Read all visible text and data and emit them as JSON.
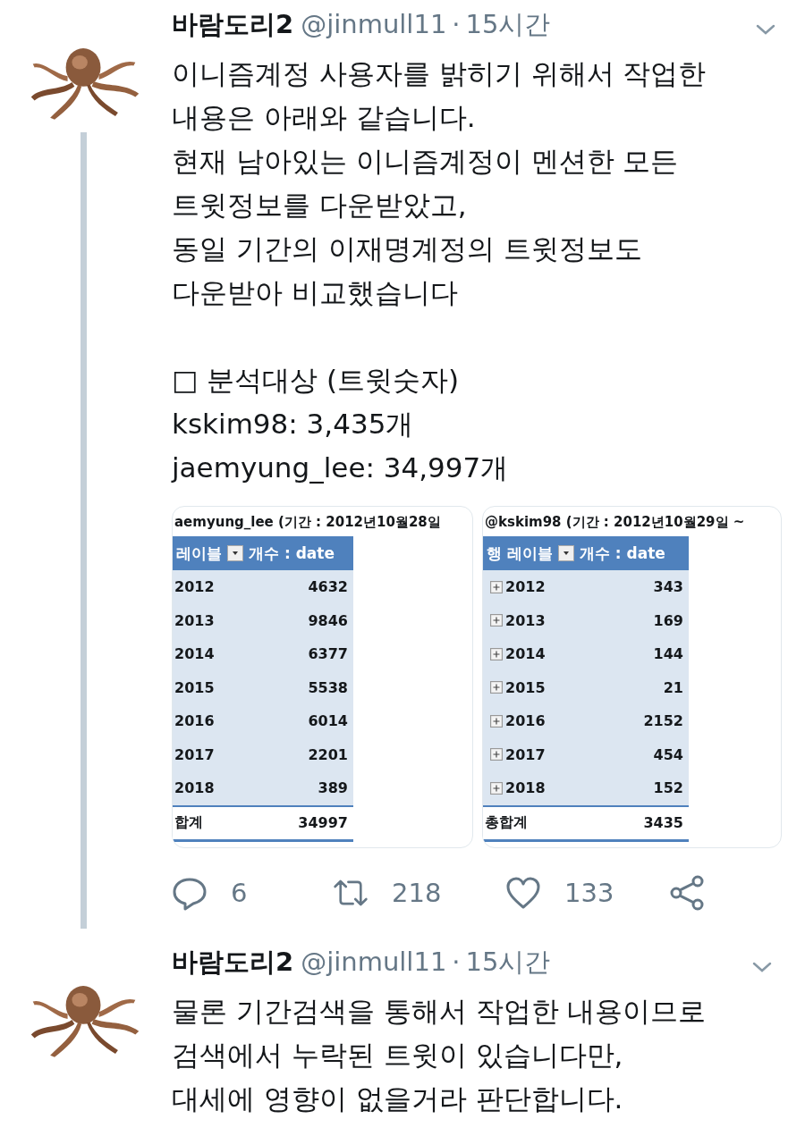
{
  "tweets": [
    {
      "author": "바람도리2",
      "handle": "@jinmull11",
      "separator": "·",
      "time": "15시간",
      "thread_line": true,
      "paragraphs": [
        [
          "이니즘계정 사용자를 밝히기 위해서 작업한",
          "내용은 아래와 같습니다.",
          "현재 남아있는 이니즘계정이 멘션한 모든",
          "트윗정보를 다운받았고,",
          "동일 기간의 이재명계정의 트윗정보도",
          "다운받아 비교했습니다"
        ],
        [
          "□ 분석대상 (트윗숫자)",
          "kskim98: 3,435개",
          "jaemyung_lee: 34,997개"
        ]
      ],
      "media": [
        {
          "title": "aemyung_lee (기간 : 2012년10월28일",
          "header": [
            "레이블",
            "개수 : date"
          ],
          "expand_buttons": false,
          "rows": [
            {
              "label": "2012",
              "value": "4632"
            },
            {
              "label": "2013",
              "value": "9846"
            },
            {
              "label": "2014",
              "value": "6377"
            },
            {
              "label": "2015",
              "value": "5538"
            },
            {
              "label": "2016",
              "value": "6014"
            },
            {
              "label": "2017",
              "value": "2201"
            },
            {
              "label": "2018",
              "value": "389"
            }
          ],
          "total": {
            "label": "합계",
            "value": "34997"
          }
        },
        {
          "title": "@kskim98 (기간 : 2012년10월29일 ~",
          "header": [
            "행 레이블",
            "개수 : date"
          ],
          "expand_buttons": true,
          "rows": [
            {
              "label": "2012",
              "value": "343"
            },
            {
              "label": "2013",
              "value": "169"
            },
            {
              "label": "2014",
              "value": "144"
            },
            {
              "label": "2015",
              "value": "21"
            },
            {
              "label": "2016",
              "value": "2152"
            },
            {
              "label": "2017",
              "value": "454"
            },
            {
              "label": "2018",
              "value": "152"
            }
          ],
          "total": {
            "label": "총합계",
            "value": "3435"
          }
        }
      ],
      "actions": [
        {
          "kind": "reply",
          "count": "6"
        },
        {
          "kind": "retweet",
          "count": "218"
        },
        {
          "kind": "like",
          "count": "133"
        },
        {
          "kind": "share"
        }
      ]
    },
    {
      "author": "바람도리2",
      "handle": "@jinmull11",
      "separator": "·",
      "time": "15시간",
      "thread_line": false,
      "paragraphs": [
        [
          "물론 기간검색을 통해서 작업한 내용이므로",
          "검색에서 누락된 트윗이 있습니다만,",
          "대세에 영향이 없을거라 판단합니다."
        ]
      ]
    }
  ]
}
